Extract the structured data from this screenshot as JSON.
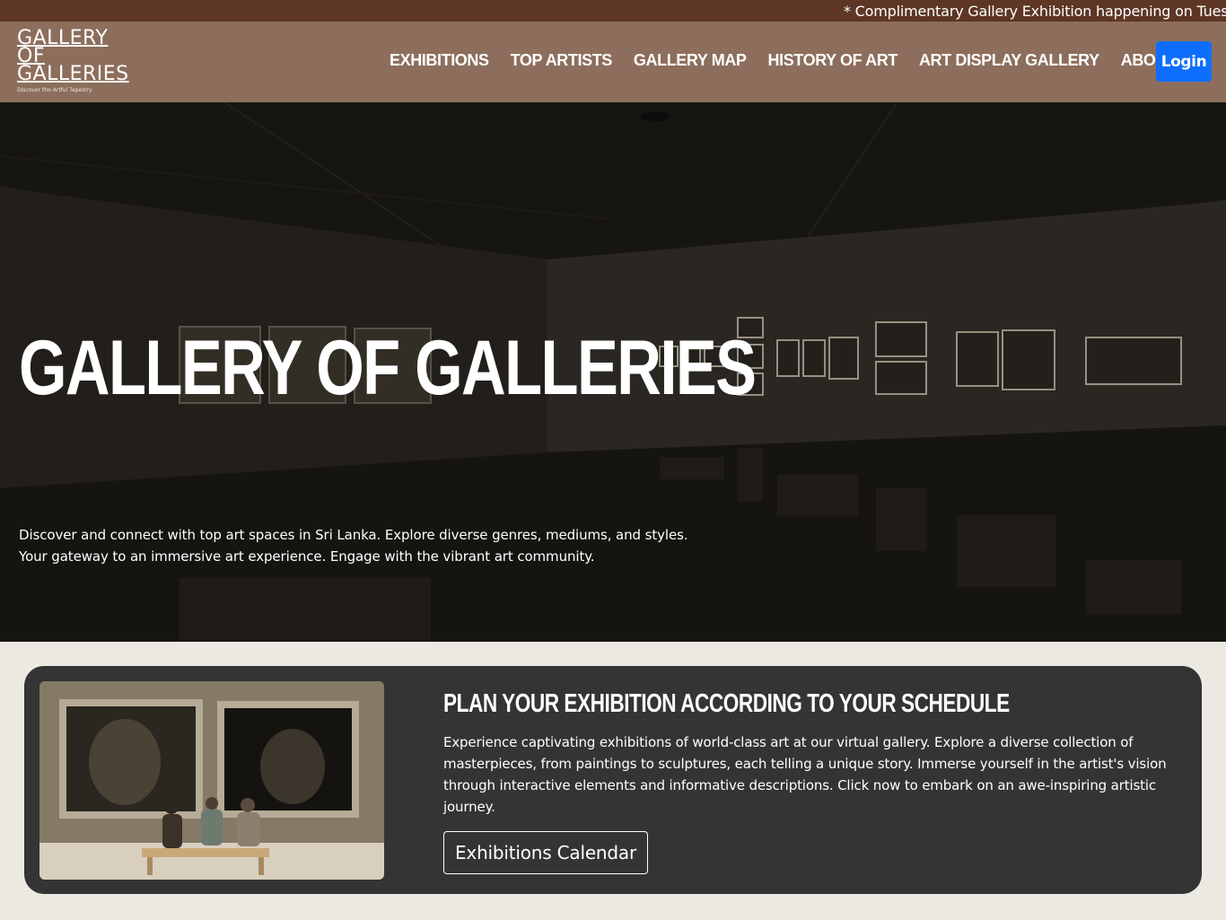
{
  "ticker": {
    "text": "* Complimentary Gallery Exhibition happening on Tuesda"
  },
  "logo": {
    "line1": "GALLERY",
    "line2": "OF",
    "line3": "GALLERIES",
    "tagline": "Discover the Artful Tapestry"
  },
  "nav": {
    "links": [
      "EXHIBITIONS",
      "TOP ARTISTS",
      "GALLERY MAP",
      "HISTORY OF ART",
      "ART DISPLAY GALLERY",
      "ABOUT"
    ],
    "login_label": "Login"
  },
  "hero": {
    "title": "GALLERY OF GALLERIES",
    "description_line1": "Discover and connect with top art spaces in Sri Lanka. Explore diverse genres, mediums, and styles.",
    "description_line2": "Your gateway to an immersive art experience. Engage with the vibrant art community."
  },
  "feature": {
    "title": "PLAN YOUR EXHIBITION ACCORDING TO YOUR SCHEDULE",
    "description": "Experience captivating exhibitions of world-class art at our virtual gallery. Explore a diverse collection of masterpieces, from paintings to sculptures, each telling a unique story. Immerse yourself in the artist's vision through interactive elements and informative descriptions. Click now to embark on an awe-inspiring artistic journey.",
    "button_label": "Exhibitions Calendar"
  },
  "colors": {
    "ticker_bg": "#5d3626",
    "navbar_bg": "#8d6e5c",
    "login_bg": "#0d6efd",
    "card_bg": "#343434",
    "page_bg": "#ebe9e2"
  }
}
